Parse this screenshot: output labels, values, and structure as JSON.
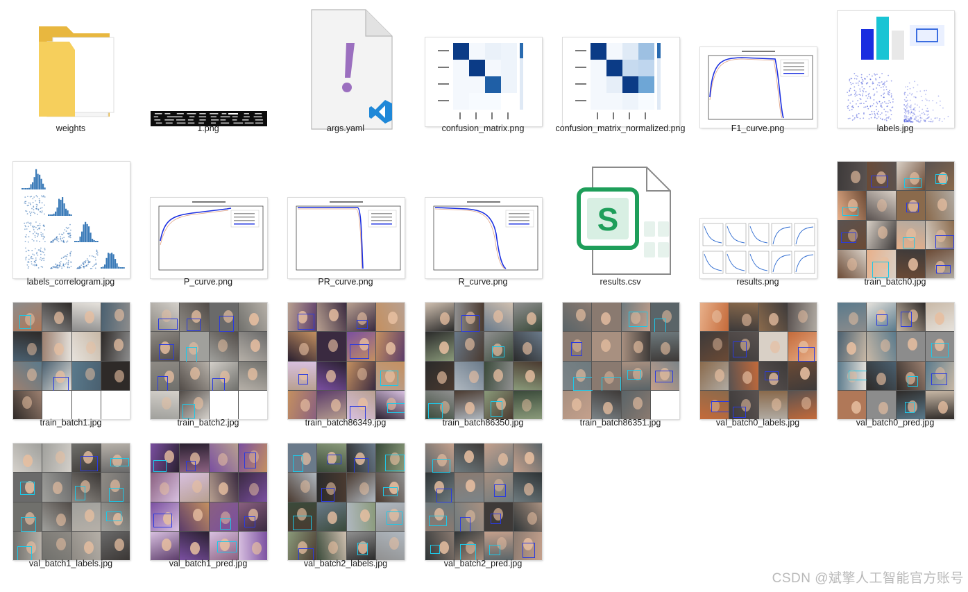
{
  "files": [
    {
      "name": "weights",
      "kind": "folder"
    },
    {
      "name": "1.png",
      "kind": "terminal"
    },
    {
      "name": "args.yaml",
      "kind": "yaml"
    },
    {
      "name": "confusion_matrix.png",
      "kind": "cm"
    },
    {
      "name": "confusion_matrix_normalized.png",
      "kind": "cmn"
    },
    {
      "name": "F1_curve.png",
      "kind": "curve"
    },
    {
      "name": "labels.jpg",
      "kind": "labels"
    },
    {
      "name": "labels_correlogram.jpg",
      "kind": "correlogram"
    },
    {
      "name": "P_curve.png",
      "kind": "curve"
    },
    {
      "name": "PR_curve.png",
      "kind": "curve"
    },
    {
      "name": "R_curve.png",
      "kind": "curve"
    },
    {
      "name": "results.csv",
      "kind": "csv"
    },
    {
      "name": "results.png",
      "kind": "results"
    },
    {
      "name": "train_batch0.jpg",
      "kind": "photos"
    },
    {
      "name": "train_batch1.jpg",
      "kind": "photos"
    },
    {
      "name": "train_batch2.jpg",
      "kind": "photos"
    },
    {
      "name": "train_batch86349.jpg",
      "kind": "photos"
    },
    {
      "name": "train_batch86350.jpg",
      "kind": "photos"
    },
    {
      "name": "train_batch86351.jpg",
      "kind": "photos"
    },
    {
      "name": "val_batch0_labels.jpg",
      "kind": "photos"
    },
    {
      "name": "val_batch0_pred.jpg",
      "kind": "photos"
    },
    {
      "name": "val_batch1_labels.jpg",
      "kind": "photos"
    },
    {
      "name": "val_batch1_pred.jpg",
      "kind": "photos"
    },
    {
      "name": "val_batch2_labels.jpg",
      "kind": "photos"
    },
    {
      "name": "val_batch2_pred.jpg",
      "kind": "photos"
    }
  ],
  "thumb_text": {
    "csv_letter": "S"
  },
  "watermark": "CSDN @斌擎人工智能官方账号",
  "colors": {
    "folder": "#f6cf5c",
    "folder_dark": "#e8b73f",
    "yaml_mark": "#9b6fbf",
    "vscode": "#1f88d8",
    "csv_green": "#1e9e5a",
    "cm_dark": "#0b3b86",
    "curve_blue": "#1a2ee0"
  }
}
